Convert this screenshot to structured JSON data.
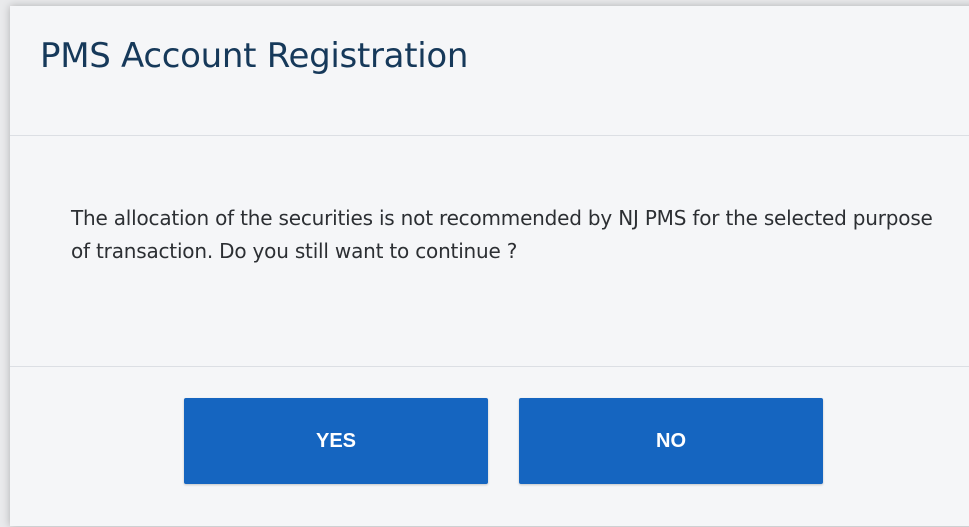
{
  "dialog": {
    "title": "PMS Account Registration",
    "message": "The allocation of the securities is not recommended by NJ PMS for the selected purpose of transaction. Do you still want to continue ?",
    "yes_label": "YES",
    "no_label": "NO"
  },
  "colors": {
    "title": "#16395a",
    "button_bg": "#1565c0",
    "button_text": "#ffffff",
    "dialog_bg": "#f5f6f8"
  }
}
